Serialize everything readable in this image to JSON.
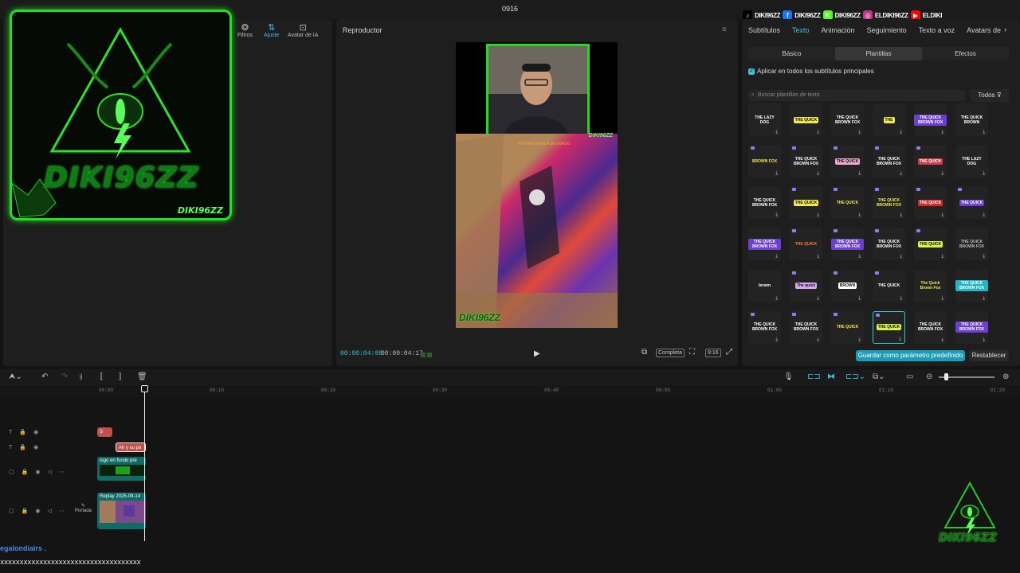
{
  "window": {
    "title": "0916"
  },
  "social": [
    {
      "label": "DIKI96ZZ",
      "icon": "tiktok-icon",
      "color": "#000000",
      "glyph": "♪"
    },
    {
      "label": "DIKI96ZZ",
      "icon": "facebook-icon",
      "color": "#1877f2",
      "glyph": "f"
    },
    {
      "label": "DIKI96ZZ",
      "icon": "kick-icon",
      "color": "#53fc18",
      "glyph": "K"
    },
    {
      "label": "ELDIKI96ZZ",
      "icon": "instagram-icon",
      "color": "#c13584",
      "glyph": "◎"
    },
    {
      "label": "ELDIKI",
      "icon": "youtube-icon",
      "color": "#ff0000",
      "glyph": "▶"
    }
  ],
  "media_panel": {
    "tools": [
      {
        "label": "Filtros",
        "icon": "filters-icon",
        "active": false
      },
      {
        "label": "Ajuste",
        "icon": "adjust-icon",
        "active": true
      },
      {
        "label": "Avatar de IA",
        "icon": "ai-avatar-icon",
        "active": false
      }
    ]
  },
  "overlay_logo": {
    "text": "DIKI96ZZ",
    "tag": "DIKI96ZZ"
  },
  "player": {
    "title": "Reproductor",
    "time_current": "00:00:04:08",
    "time_total": "00:00:04:17",
    "fit_label": "Completa",
    "ratio_label": "9:16",
    "game_text": "PORTAESPIRE ASESINADO",
    "game_logo": "DIKI96ZZ",
    "cam_label": "DIKI96ZZ"
  },
  "props": {
    "tabs": [
      {
        "label": "Subtítulos",
        "active": false
      },
      {
        "label": "Texto",
        "active": true
      },
      {
        "label": "Animación",
        "active": false
      },
      {
        "label": "Seguimiento",
        "active": false
      },
      {
        "label": "Texto a voz",
        "active": false
      },
      {
        "label": "Avatars de",
        "active": false
      }
    ],
    "sub_tabs": [
      {
        "label": "Básico",
        "active": false
      },
      {
        "label": "Plantillas",
        "active": true
      },
      {
        "label": "Efectos",
        "active": false
      }
    ],
    "apply_all_label": "Aplicar en todos los subtítulos principales",
    "apply_all_checked": true,
    "search_placeholder": "Buscar plantillas de texto",
    "filter_label": "Todos",
    "save_preset_label": "Guardar como parámetro predefinido",
    "reset_label": "Restablecer",
    "templates": [
      {
        "text": "THE LAZY DOG",
        "fg": "#ffffff",
        "bg": "",
        "crown": false
      },
      {
        "text": "THE QUICK",
        "fg": "#111111",
        "bg": "#f2e94a",
        "crown": false
      },
      {
        "text": "THE QUICK BROWN FOX",
        "fg": "#ffffff",
        "bg": "",
        "crown": false
      },
      {
        "text": "THE",
        "fg": "#111111",
        "bg": "#f2e94a",
        "crown": false
      },
      {
        "text": "THE QUICK BROWN FOX",
        "fg": "#ffffff",
        "bg": "#6a3fd1",
        "crown": false
      },
      {
        "text": "THE QUICK BROWN",
        "fg": "#ffffff",
        "bg": "",
        "crown": false
      },
      {
        "text": "BROWN FOX",
        "fg": "#f2e94a",
        "bg": "",
        "crown": true
      },
      {
        "text": "THE QUICK BROWN FOX",
        "fg": "#ffffff",
        "bg": "",
        "crown": true
      },
      {
        "text": "THE QUICK",
        "fg": "#111111",
        "bg": "#f3a6d2",
        "crown": true
      },
      {
        "text": "THE QUICK BROWN FOX",
        "fg": "#ffffff",
        "bg": "",
        "crown": true
      },
      {
        "text": "THE QUICK",
        "fg": "#ffffff",
        "bg": "#d63a4a",
        "crown": true
      },
      {
        "text": "THE LAZY DOG",
        "fg": "#ffffff",
        "bg": "",
        "crown": false
      },
      {
        "text": "THE QUICK BROWN FOX",
        "fg": "#ffffff",
        "bg": "",
        "crown": false
      },
      {
        "text": "THE QUICK",
        "fg": "#111111",
        "bg": "#f2e94a",
        "crown": true
      },
      {
        "text": "THE QUICK",
        "fg": "#f2e94a",
        "bg": "",
        "crown": true
      },
      {
        "text": "THE QUICK BROWN FOX",
        "fg": "#f2e94a",
        "bg": "",
        "crown": true
      },
      {
        "text": "THE QUICK",
        "fg": "#ffffff",
        "bg": "#d62a2a",
        "crown": true
      },
      {
        "text": "THE QUICK",
        "fg": "#ffffff",
        "bg": "#6a3fd1",
        "crown": true
      },
      {
        "text": "THE QUICK BROWN FOX",
        "fg": "#ffffff",
        "bg": "#6a3fd1",
        "crown": false
      },
      {
        "text": "THE QUICK",
        "fg": "#ff7a3a",
        "bg": "",
        "crown": true
      },
      {
        "text": "THE QUICK BROWN FOX",
        "fg": "#ffffff",
        "bg": "#6a3fd1",
        "crown": true
      },
      {
        "text": "THE QUICK BROWN FOX",
        "fg": "#ffffff",
        "bg": "",
        "crown": true
      },
      {
        "text": "THE QUICK",
        "fg": "#111111",
        "bg": "#d8f24a",
        "crown": true
      },
      {
        "text": "THE QUICK BROWN FOX",
        "fg": "#bbbbbb",
        "bg": "",
        "crown": false
      },
      {
        "text": "brown",
        "fg": "#ffffff",
        "bg": "",
        "crown": false
      },
      {
        "text": "The quick",
        "fg": "#111111",
        "bg": "#d9a8f2",
        "crown": true
      },
      {
        "text": "BROWN",
        "fg": "#111111",
        "bg": "#ffffff",
        "crown": true
      },
      {
        "text": "THE QUICK",
        "fg": "#ffffff",
        "bg": "",
        "crown": true
      },
      {
        "text": "The Quick Brown Fox",
        "fg": "#f2e94a",
        "bg": "",
        "crown": false
      },
      {
        "text": "THE QUICK BROWN FOX",
        "fg": "#ffffff",
        "bg": "#22b5c8",
        "crown": false
      },
      {
        "text": "THE QUICK BROWN FOX",
        "fg": "#ffffff",
        "bg": "",
        "crown": true
      },
      {
        "text": "THE QUICK BROWN FOX",
        "fg": "#ffffff",
        "bg": "",
        "crown": true
      },
      {
        "text": "THE QUICK",
        "fg": "#f2e94a",
        "bg": "",
        "crown": true
      },
      {
        "text": "THE QUICK",
        "fg": "#111111",
        "bg": "#d8f24a",
        "crown": true,
        "selected": true
      },
      {
        "text": "THE QUICK BROWN FOX",
        "fg": "#ffffff",
        "bg": "",
        "crown": false
      },
      {
        "text": "THE QUICK BROWN FOX",
        "fg": "#ffffff",
        "bg": "#6a3fd1",
        "crown": false
      }
    ]
  },
  "timeline": {
    "ruler": [
      "00:00",
      "00:10",
      "00:20",
      "00:30",
      "00:40",
      "00:50",
      "01:00",
      "01:10",
      "01:20"
    ],
    "clips": {
      "text1": "S",
      "text2": "Ah y su pe",
      "overlay": "logo en fondo pre",
      "main": "Replay 2025-09-14"
    },
    "cover_label": "Portada"
  },
  "bottom": {
    "line1": "egalondiairs .",
    "line2": "xxxxxxxxxxxxxxxxxxxxxxxxxxxxxxxxxxxx"
  },
  "corner_logo": {
    "text": "DIKI96ZZ"
  },
  "colors": {
    "accent": "#3fc0d8",
    "neon_green": "#20e020"
  }
}
